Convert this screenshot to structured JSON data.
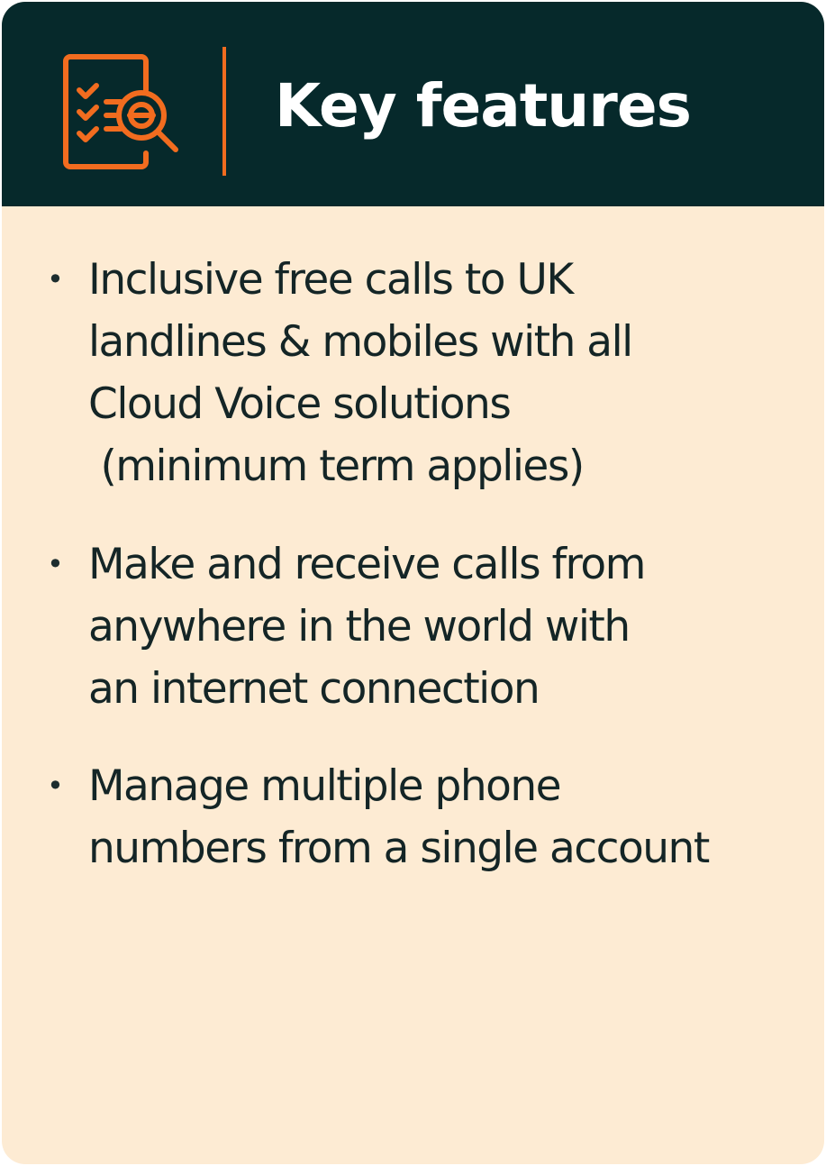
{
  "header": {
    "title": "Key features",
    "icon": "checklist-magnifier-icon",
    "background_color": "#06292b",
    "accent_color": "#f26c1f"
  },
  "body": {
    "background_color": "#fdebd3",
    "text_color": "#142526"
  },
  "features": [
    {
      "lines": [
        "Inclusive free calls to UK",
        "landlines & mobiles with all",
        "Cloud Voice solutions",
        " (minimum term applies)"
      ]
    },
    {
      "lines": [
        "Make and receive calls from",
        "anywhere in the world with",
        "an internet connection"
      ]
    },
    {
      "lines": [
        "Manage multiple phone",
        "numbers from a single account"
      ]
    }
  ]
}
